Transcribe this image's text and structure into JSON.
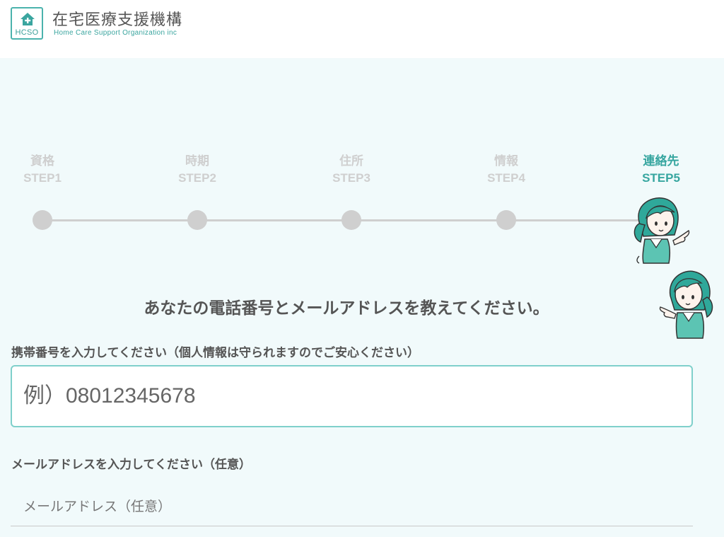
{
  "header": {
    "logo_abbr": "HCSO",
    "title": "在宅医療支援機構",
    "subtitle": "Home Care Support Organization inc"
  },
  "steps": [
    {
      "name": "資格",
      "label": "STEP1",
      "state": "inactive"
    },
    {
      "name": "時期",
      "label": "STEP2",
      "state": "inactive"
    },
    {
      "name": "住所",
      "label": "STEP3",
      "state": "inactive"
    },
    {
      "name": "情報",
      "label": "STEP4",
      "state": "inactive"
    },
    {
      "name": "連絡先",
      "label": "STEP5",
      "state": "active"
    }
  ],
  "form": {
    "question": "あなたの電話番号とメールアドレスを教えてください。",
    "phone_label": "携帯番号を入力してください（個人情報は守られますのでご安心ください）",
    "phone_placeholder": "例）08012345678",
    "email_label": "メールアドレスを入力してください（任意）",
    "email_placeholder": "メールアドレス（任意）"
  },
  "colors": {
    "accent": "#37a6a0",
    "background": "#f1fafb",
    "inactive": "#cfcfcf",
    "input_border": "#7fd0cb"
  },
  "icons": [
    "house-cross-icon",
    "nurse-illustration"
  ]
}
